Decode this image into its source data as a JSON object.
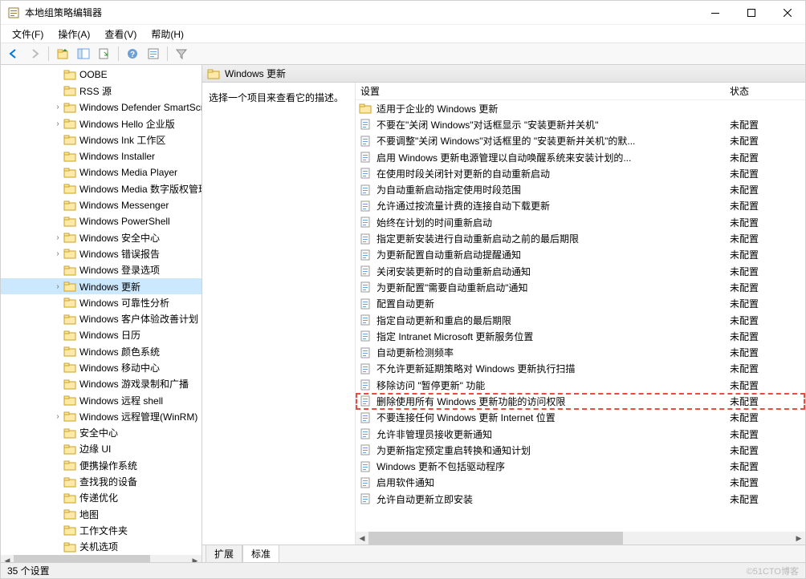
{
  "window": {
    "title": "本地组策略编辑器"
  },
  "menubar": [
    {
      "label": "文件(F)"
    },
    {
      "label": "操作(A)"
    },
    {
      "label": "查看(V)"
    },
    {
      "label": "帮助(H)"
    }
  ],
  "header": {
    "title": "Windows 更新"
  },
  "desc_panel": {
    "text": "选择一个项目来查看它的描述。"
  },
  "columns": {
    "setting": "设置",
    "status": "状态"
  },
  "tree": [
    {
      "indent": 4,
      "label": "OOBE",
      "expander": ""
    },
    {
      "indent": 4,
      "label": "RSS 源",
      "expander": ""
    },
    {
      "indent": 4,
      "label": "Windows Defender SmartScreen",
      "expander": ">"
    },
    {
      "indent": 4,
      "label": "Windows Hello 企业版",
      "expander": ">"
    },
    {
      "indent": 4,
      "label": "Windows Ink 工作区",
      "expander": ""
    },
    {
      "indent": 4,
      "label": "Windows Installer",
      "expander": ""
    },
    {
      "indent": 4,
      "label": "Windows Media Player",
      "expander": ""
    },
    {
      "indent": 4,
      "label": "Windows Media 数字版权管理",
      "expander": ""
    },
    {
      "indent": 4,
      "label": "Windows Messenger",
      "expander": ""
    },
    {
      "indent": 4,
      "label": "Windows PowerShell",
      "expander": ""
    },
    {
      "indent": 4,
      "label": "Windows 安全中心",
      "expander": ">"
    },
    {
      "indent": 4,
      "label": "Windows 错误报告",
      "expander": ">"
    },
    {
      "indent": 4,
      "label": "Windows 登录选项",
      "expander": ""
    },
    {
      "indent": 4,
      "label": "Windows 更新",
      "expander": ">",
      "selected": true
    },
    {
      "indent": 4,
      "label": "Windows 可靠性分析",
      "expander": ""
    },
    {
      "indent": 4,
      "label": "Windows 客户体验改善计划",
      "expander": ""
    },
    {
      "indent": 4,
      "label": "Windows 日历",
      "expander": ""
    },
    {
      "indent": 4,
      "label": "Windows 颜色系统",
      "expander": ""
    },
    {
      "indent": 4,
      "label": "Windows 移动中心",
      "expander": ""
    },
    {
      "indent": 4,
      "label": "Windows 游戏录制和广播",
      "expander": ""
    },
    {
      "indent": 4,
      "label": "Windows 远程 shell",
      "expander": ""
    },
    {
      "indent": 4,
      "label": "Windows 远程管理(WinRM)",
      "expander": ">"
    },
    {
      "indent": 4,
      "label": "安全中心",
      "expander": ""
    },
    {
      "indent": 4,
      "label": "边缘 UI",
      "expander": ""
    },
    {
      "indent": 4,
      "label": "便携操作系统",
      "expander": ""
    },
    {
      "indent": 4,
      "label": "查找我的设备",
      "expander": ""
    },
    {
      "indent": 4,
      "label": "传递优化",
      "expander": ""
    },
    {
      "indent": 4,
      "label": "地图",
      "expander": ""
    },
    {
      "indent": 4,
      "label": "工作文件夹",
      "expander": ""
    },
    {
      "indent": 4,
      "label": "关机选项",
      "expander": ""
    }
  ],
  "settings": [
    {
      "type": "folder",
      "name": "适用于企业的 Windows 更新",
      "status": ""
    },
    {
      "type": "policy",
      "name": "不要在\"关闭 Windows\"对话框显示 \"安装更新并关机\"",
      "status": "未配置"
    },
    {
      "type": "policy",
      "name": "不要调整\"关闭 Windows\"对话框里的 \"安装更新并关机\"的默...",
      "status": "未配置"
    },
    {
      "type": "policy",
      "name": "启用 Windows 更新电源管理以自动唤醒系统来安装计划的...",
      "status": "未配置"
    },
    {
      "type": "policy",
      "name": "在使用时段关闭针对更新的自动重新启动",
      "status": "未配置"
    },
    {
      "type": "policy",
      "name": "为自动重新启动指定使用时段范围",
      "status": "未配置"
    },
    {
      "type": "policy",
      "name": "允许通过按流量计费的连接自动下载更新",
      "status": "未配置"
    },
    {
      "type": "policy",
      "name": "始终在计划的时间重新启动",
      "status": "未配置"
    },
    {
      "type": "policy",
      "name": "指定更新安装进行自动重新启动之前的最后期限",
      "status": "未配置"
    },
    {
      "type": "policy",
      "name": "为更新配置自动重新启动提醒通知",
      "status": "未配置"
    },
    {
      "type": "policy",
      "name": "关闭安装更新时的自动重新启动通知",
      "status": "未配置"
    },
    {
      "type": "policy",
      "name": "为更新配置\"需要自动重新启动\"通知",
      "status": "未配置"
    },
    {
      "type": "policy",
      "name": "配置自动更新",
      "status": "未配置"
    },
    {
      "type": "policy",
      "name": "指定自动更新和重启的最后期限",
      "status": "未配置"
    },
    {
      "type": "policy",
      "name": "指定 Intranet Microsoft 更新服务位置",
      "status": "未配置"
    },
    {
      "type": "policy",
      "name": "自动更新检测频率",
      "status": "未配置"
    },
    {
      "type": "policy",
      "name": "不允许更新延期策略对 Windows 更新执行扫描",
      "status": "未配置"
    },
    {
      "type": "policy",
      "name": "移除访问 \"暂停更新\" 功能",
      "status": "未配置"
    },
    {
      "type": "policy",
      "name": "删除使用所有 Windows 更新功能的访问权限",
      "status": "未配置",
      "highlighted": true
    },
    {
      "type": "policy",
      "name": "不要连接任何 Windows 更新 Internet 位置",
      "status": "未配置"
    },
    {
      "type": "policy",
      "name": "允许非管理员接收更新通知",
      "status": "未配置"
    },
    {
      "type": "policy",
      "name": "为更新指定预定重启转换和通知计划",
      "status": "未配置"
    },
    {
      "type": "policy",
      "name": "Windows 更新不包括驱动程序",
      "status": "未配置"
    },
    {
      "type": "policy",
      "name": "启用软件通知",
      "status": "未配置"
    },
    {
      "type": "policy",
      "name": "允许自动更新立即安装",
      "status": "未配置"
    }
  ],
  "tabs": [
    {
      "label": "扩展",
      "active": false
    },
    {
      "label": "标准",
      "active": true
    }
  ],
  "statusbar": {
    "text": "35 个设置",
    "watermark": "©51CTO博客"
  }
}
